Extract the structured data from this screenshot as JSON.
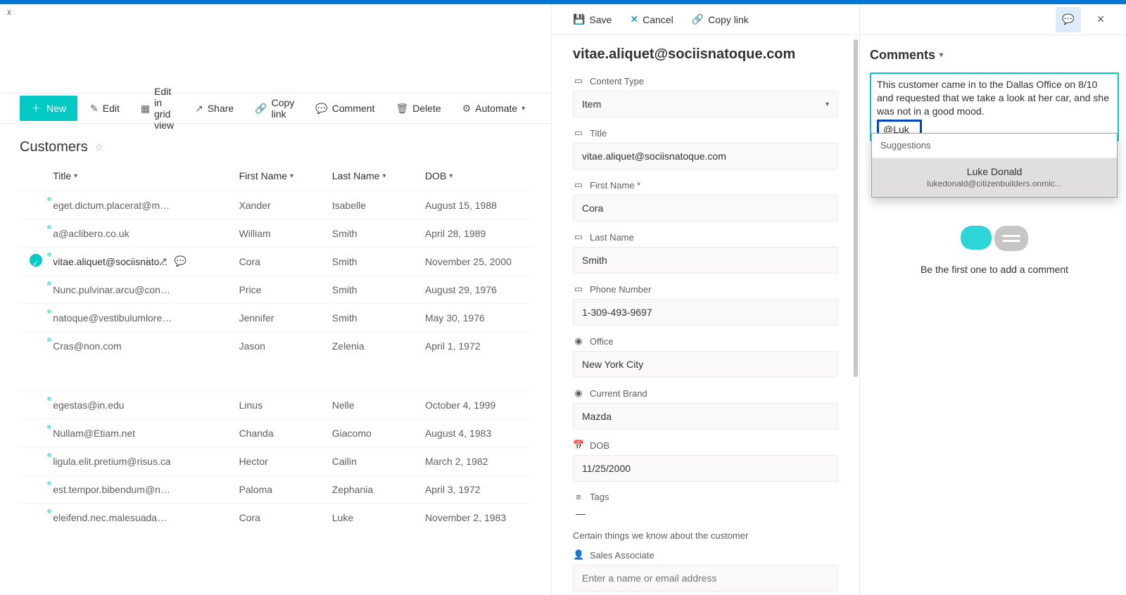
{
  "breadcrumb_stub": "x",
  "toolbar": {
    "new": "New",
    "edit": "Edit",
    "edit_grid": "Edit in grid view",
    "share": "Share",
    "copy_link": "Copy link",
    "comment": "Comment",
    "delete": "Delete",
    "automate": "Automate"
  },
  "list": {
    "title": "Customers",
    "columns": {
      "title": "Title",
      "first_name": "First Name",
      "last_name": "Last Name",
      "dob": "DOB"
    },
    "rows": [
      {
        "title": "eget.dictum.placerat@mattis.ca",
        "first": "Xander",
        "last": "Isabelle",
        "dob": "August 15, 1988",
        "selected": false
      },
      {
        "title": "a@aclibero.co.uk",
        "first": "William",
        "last": "Smith",
        "dob": "April 28, 1989",
        "selected": false
      },
      {
        "title": "vitae.aliquet@sociisnato...",
        "first": "Cora",
        "last": "Smith",
        "dob": "November 25, 2000",
        "selected": true
      },
      {
        "title": "Nunc.pulvinar.arcu@conubianostraper.edu",
        "first": "Price",
        "last": "Smith",
        "dob": "August 29, 1976",
        "selected": false
      },
      {
        "title": "natoque@vestibulumlorem.edu",
        "first": "Jennifer",
        "last": "Smith",
        "dob": "May 30, 1976",
        "selected": false
      },
      {
        "title": "Cras@non.com",
        "first": "Jason",
        "last": "Zelenia",
        "dob": "April 1, 1972",
        "selected": false
      }
    ],
    "rows2": [
      {
        "title": "egestas@in.edu",
        "first": "Linus",
        "last": "Nelle",
        "dob": "October 4, 1999"
      },
      {
        "title": "Nullam@Etiam.net",
        "first": "Chanda",
        "last": "Giacomo",
        "dob": "August 4, 1983"
      },
      {
        "title": "ligula.elit.pretium@risus.ca",
        "first": "Hector",
        "last": "Cailin",
        "dob": "March 2, 1982"
      },
      {
        "title": "est.tempor.bibendum@neccursusa.com",
        "first": "Paloma",
        "last": "Zephania",
        "dob": "April 3, 1972"
      },
      {
        "title": "eleifend.nec.malesuada@atrisus.ca",
        "first": "Cora",
        "last": "Luke",
        "dob": "November 2, 1983"
      }
    ]
  },
  "detail": {
    "toolbar": {
      "save": "Save",
      "cancel": "Cancel",
      "copy_link": "Copy link"
    },
    "header": "vitae.aliquet@sociisnatoque.com",
    "fields": {
      "content_type": {
        "label": "Content Type",
        "value": "Item"
      },
      "title": {
        "label": "Title",
        "value": "vitae.aliquet@sociisnatoque.com"
      },
      "first_name": {
        "label": "First Name *",
        "value": "Cora"
      },
      "last_name": {
        "label": "Last Name",
        "value": "Smith"
      },
      "phone": {
        "label": "Phone Number",
        "value": "1-309-493-9697"
      },
      "office": {
        "label": "Office",
        "value": "New York City"
      },
      "brand": {
        "label": "Current Brand",
        "value": "Mazda"
      },
      "dob": {
        "label": "DOB",
        "value": "11/25/2000"
      },
      "tags": {
        "label": "Tags",
        "value": "—"
      },
      "section_note": "Certain things we know about the customer",
      "sales_assoc": {
        "label": "Sales Associate",
        "placeholder": "Enter a name or email address"
      }
    }
  },
  "comments": {
    "title": "Comments",
    "draft_text": "This customer came in to the Dallas Office on 8/10 and requested that we take a look at her car, and she was not in a good mood.",
    "mention_partial": "@Luk",
    "suggestions_label": "Suggestions",
    "suggestion": {
      "name": "Luke Donald",
      "email": "lukedonald@citizenbuilders.onmic..."
    },
    "empty_text": "Be the first one to add a comment"
  }
}
